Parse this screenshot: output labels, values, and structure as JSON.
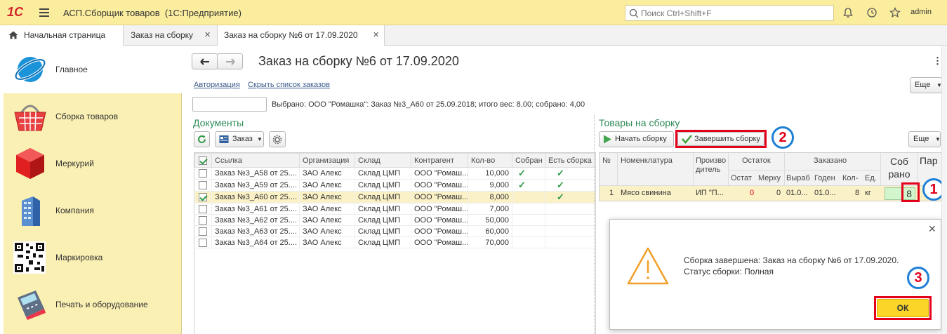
{
  "app": {
    "logo": "1С",
    "title": "АСП.Сборщик товаров  (1С:Предприятие)",
    "search_placeholder": "Поиск Ctrl+Shift+F",
    "user": "admin"
  },
  "tabs": [
    {
      "label": "Начальная страница"
    },
    {
      "label": "Заказ на сборку"
    },
    {
      "label": "Заказ на сборку №6 от 17.09.2020"
    }
  ],
  "sidebar": {
    "items": [
      {
        "label": "Главное"
      },
      {
        "label": "Сборка товаров"
      },
      {
        "label": "Меркурий"
      },
      {
        "label": "Компания"
      },
      {
        "label": "Маркировка"
      },
      {
        "label": "Печать и оборудование"
      }
    ]
  },
  "form": {
    "title": "Заказ на сборку №6 от 17.09.2020",
    "links": {
      "auth": "Авторизация",
      "hide": "Скрыть список заказов"
    },
    "more": "Еще",
    "selected_info": "Выбрано: ООО \"Ромашка\": Заказ №3_А60 от 25.09.2018; итого вес: 8,00; собрано: 4,00"
  },
  "docs": {
    "title": "Документы",
    "order_btn": "Заказ",
    "columns": [
      "Ссылка",
      "Организация",
      "Склад",
      "Контрагент",
      "Кол-во",
      "Собран",
      "Есть сборка"
    ],
    "rows": [
      {
        "ref": "Заказ №3_А58 от 25....",
        "org": "ЗАО Алекс",
        "wh": "Склад ЦМП",
        "cp": "ООО \"Ромаш...",
        "qty": "10,000",
        "checked": false,
        "collected": "✓",
        "has": "✓"
      },
      {
        "ref": "Заказ №3_А59 от 25....",
        "org": "ЗАО Алекс",
        "wh": "Склад ЦМП",
        "cp": "ООО \"Ромаш...",
        "qty": "9,000",
        "checked": false,
        "collected": "✓",
        "has": "✓"
      },
      {
        "ref": "Заказ №3_А60 от 25....",
        "org": "ЗАО Алекс",
        "wh": "Склад ЦМП",
        "cp": "ООО \"Ромаш...",
        "qty": "8,000",
        "checked": true,
        "collected": "",
        "has": "✓"
      },
      {
        "ref": "Заказ №3_А61 от 25....",
        "org": "ЗАО Алекс",
        "wh": "Склад ЦМП",
        "cp": "ООО \"Ромаш...",
        "qty": "7,000",
        "checked": false,
        "collected": "",
        "has": ""
      },
      {
        "ref": "Заказ №3_А62 от 25....",
        "org": "ЗАО Алекс",
        "wh": "Склад ЦМП",
        "cp": "ООО \"Ромаш...",
        "qty": "50,000",
        "checked": false,
        "collected": "",
        "has": ""
      },
      {
        "ref": "Заказ №3_А63 от 25....",
        "org": "ЗАО Алекс",
        "wh": "Склад ЦМП",
        "cp": "ООО \"Ромаш...",
        "qty": "60,000",
        "checked": false,
        "collected": "",
        "has": ""
      },
      {
        "ref": "Заказ №3_А64 от 25....",
        "org": "ЗАО Алекс",
        "wh": "Склад ЦМП",
        "cp": "ООО \"Ромаш...",
        "qty": "70,000",
        "checked": false,
        "collected": "",
        "has": ""
      }
    ]
  },
  "goods": {
    "title": "Товары на сборку",
    "start_btn": "Начать сборку",
    "finish_btn": "Завершить сборку",
    "more": "Еще",
    "headers": {
      "n": "№",
      "nom": "Номенклатура",
      "prod": "Производитель",
      "ostatok": "Остаток",
      "ordered": "Заказано",
      "ost": "Остат",
      "merk": "Мерку",
      "vyrab": "Выраб",
      "goden": "Годен",
      "kol": "Кол-",
      "ed": "Ед.",
      "sobrano": "Соб рано",
      "par": "Пар"
    },
    "row": {
      "n": "1",
      "nom": "Мясо свинина",
      "prod": "ИП \"П...",
      "ost": "0",
      "merk": "0",
      "vyrab": "01.0...",
      "goden": "01.0...",
      "kol": "8",
      "ed": "кг",
      "sobrano": "8"
    }
  },
  "dialog": {
    "line1": "Сборка завершена: Заказ на сборку №6 от 17.09.2020.",
    "line2": "Статус сборки: Полная",
    "ok": "ОК"
  },
  "markers": {
    "m1": "1",
    "m2": "2",
    "m3": "3"
  }
}
